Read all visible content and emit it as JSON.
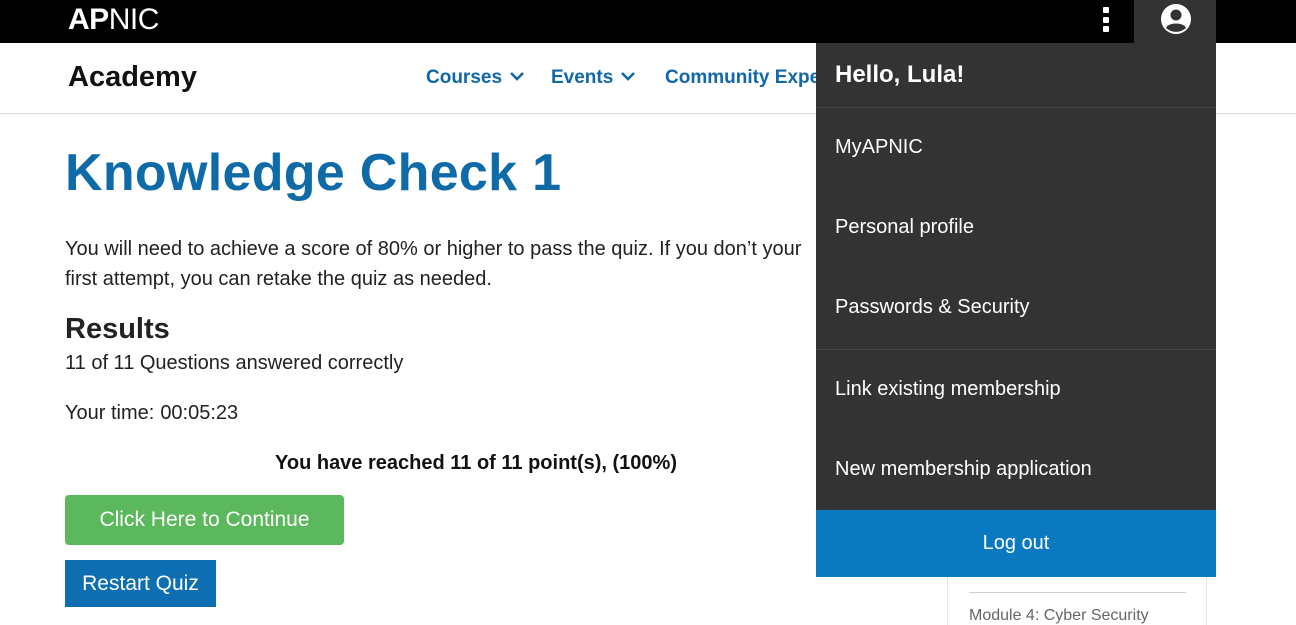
{
  "topbar": {
    "logo_bold": "AP",
    "logo_regular": "NIC",
    "menu_icon": "kebab-vertical-icon",
    "user_icon": "user-circle-icon"
  },
  "subheader": {
    "site_title": "Academy",
    "nav": [
      {
        "label": "Courses",
        "icon": "chevron-down-icon"
      },
      {
        "label": "Events",
        "icon": "chevron-down-icon"
      },
      {
        "label": "Community Exper"
      }
    ]
  },
  "page": {
    "title": "Knowledge Check 1",
    "intro": "You will need to achieve a score of 80% or higher to pass the quiz. If you don’t your first attempt, you can retake the quiz as needed.",
    "results_heading": "Results",
    "answered": "11 of 11 Questions answered correctly",
    "time_label": "Your time:",
    "time_value": "00:05:23",
    "points": "You have reached 11 of 11 point(s), (100%)",
    "continue_button": "Click Here to Continue",
    "restart_button": "Restart Quiz"
  },
  "sidebar": {
    "module_label": "Module 4: Cyber Security"
  },
  "user_menu": {
    "greeting": "Hello, Lula!",
    "items": [
      "MyAPNIC",
      "Personal profile",
      "Passwords & Security",
      "Link existing membership",
      "New membership application"
    ],
    "logout": "Log out"
  },
  "colors": {
    "topbar": "#000000",
    "brand_blue": "#0f6aa8",
    "dropdown_bg": "#333333",
    "logout_bg": "#0a79c0",
    "continue_green": "#5cb85c",
    "restart_blue": "#0d6fb1"
  }
}
